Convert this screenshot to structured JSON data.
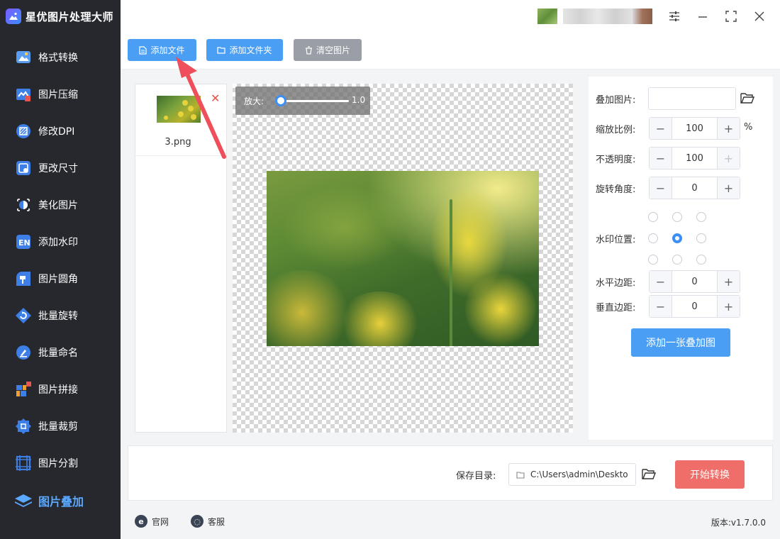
{
  "app": {
    "title": "星优图片处理大师"
  },
  "sidebar": {
    "items": [
      {
        "label": "格式转换"
      },
      {
        "label": "图片压缩"
      },
      {
        "label": "修改DPI"
      },
      {
        "label": "更改尺寸"
      },
      {
        "label": "美化图片"
      },
      {
        "label": "添加水印"
      },
      {
        "label": "图片圆角"
      },
      {
        "label": "批量旋转"
      },
      {
        "label": "批量命名"
      },
      {
        "label": "图片拼接"
      },
      {
        "label": "批量裁剪"
      },
      {
        "label": "图片分割"
      },
      {
        "label": "图片叠加",
        "active": true
      }
    ]
  },
  "toolbar": {
    "add_file": "添加文件",
    "add_folder": "添加文件夹",
    "clear": "清空图片"
  },
  "files": [
    {
      "name": "3.png"
    }
  ],
  "preview": {
    "zoom_label": "放大:",
    "zoom_value": "1.0",
    "zoom_level": 0.0
  },
  "settings": {
    "overlay_label": "叠加图片:",
    "scale_label": "缩放比例:",
    "scale_value": "100",
    "scale_unit": "%",
    "opacity_label": "不透明度:",
    "opacity_value": "100",
    "rotate_label": "旋转角度:",
    "rotate_value": "0",
    "position_label": "水印位置:",
    "position_selected": "center",
    "h_margin_label": "水平边距:",
    "h_margin_value": "0",
    "v_margin_label": "垂直边距:",
    "v_margin_value": "0",
    "add_overlay": "添加一张叠加图"
  },
  "output": {
    "save_label": "保存目录:",
    "path": "C:\\Users\\admin\\Deskto",
    "start": "开始转换"
  },
  "footer": {
    "website": "官网",
    "support": "客服",
    "version": "版本:v1.7.0.0"
  },
  "colors": {
    "sidebar_bg": "#26282e",
    "accent": "#4a9ff5",
    "start_button": "#f06e6a",
    "active_nav": "#5aa8ff",
    "annotation_arrow": "#ef4e5b"
  }
}
